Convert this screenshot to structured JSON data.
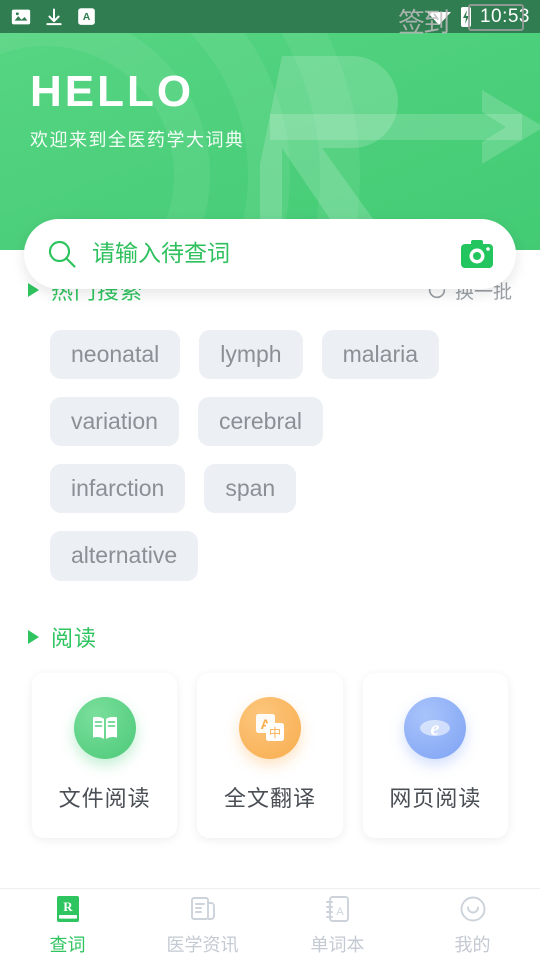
{
  "statusbar": {
    "time": "10:53",
    "watermark": "签到",
    "icons": [
      "image-icon",
      "download-icon",
      "app-a-icon",
      "wifi-icon",
      "battery-icon"
    ]
  },
  "header": {
    "greeting": "HELLO",
    "subtitle": "欢迎来到全医药学大词典",
    "watermark_symbol": "R",
    "bg_color": "#4ed07c"
  },
  "search": {
    "placeholder": "请输入待查词",
    "value": "",
    "search_icon": "search-icon",
    "camera_icon": "camera-icon",
    "accent": "#2ec45f"
  },
  "hot_search": {
    "title": "热门搜索",
    "refresh_label": "换一批",
    "refresh_icon": "refresh-icon",
    "tags": [
      "neonatal",
      "lymph",
      "malaria",
      "variation",
      "cerebral",
      "infarction",
      "span",
      "alternative"
    ]
  },
  "reading": {
    "title": "阅读",
    "cards": [
      {
        "label": "文件阅读",
        "icon": "open-book-icon",
        "color": "#4cc978"
      },
      {
        "label": "全文翻译",
        "icon": "translate-icon",
        "color": "#f8ad4e"
      },
      {
        "label": "网页阅读",
        "icon": "browser-e-icon",
        "color": "#7ea2f3"
      }
    ]
  },
  "bottom_nav": {
    "active_color": "#2ec45f",
    "inactive_color": "#c3cad2",
    "items": [
      {
        "label": "查词",
        "icon": "rx-book-icon",
        "active": true
      },
      {
        "label": "医学资讯",
        "icon": "news-document-icon",
        "active": false
      },
      {
        "label": "单词本",
        "icon": "notebook-a-icon",
        "active": false
      },
      {
        "label": "我的",
        "icon": "smiley-face-icon",
        "active": false
      }
    ]
  }
}
